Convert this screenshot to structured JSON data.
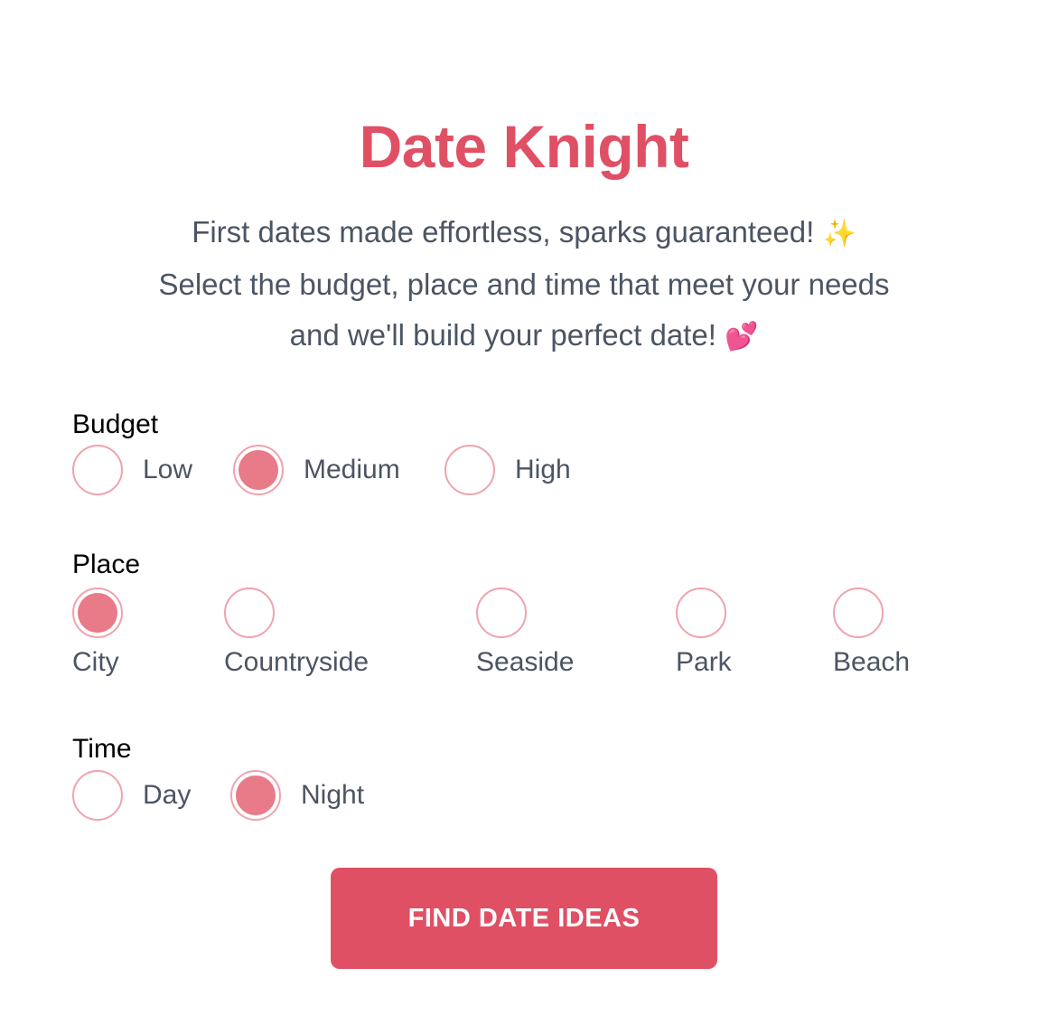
{
  "header": {
    "title": "Date Knight",
    "subtitle_line1": "First dates made effortless, sparks guaranteed!",
    "subtitle_line1_emoji": "✨",
    "subtitle_line2": "Select the budget, place and time that meet your needs",
    "subtitle_line3": "and we'll build your perfect date!",
    "subtitle_line3_emoji": "💕"
  },
  "budget": {
    "label": "Budget",
    "options": [
      "Low",
      "Medium",
      "High"
    ],
    "selected": "Medium"
  },
  "place": {
    "label": "Place",
    "options": [
      "City",
      "Countryside",
      "Seaside",
      "Park",
      "Beach"
    ],
    "selected": "City"
  },
  "time": {
    "label": "Time",
    "options": [
      "Day",
      "Night"
    ],
    "selected": "Night"
  },
  "cta": {
    "label": "FIND DATE IDEAS"
  },
  "colors": {
    "accent": "#e05065",
    "radio_fill": "#e97a87",
    "radio_border": "#f0a3ad",
    "text": "#4b5563"
  }
}
